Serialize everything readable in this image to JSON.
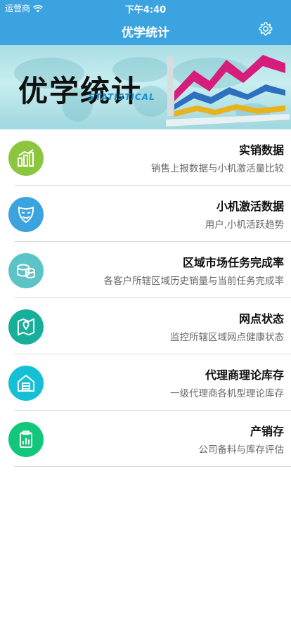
{
  "status_bar": {
    "carrier": "运营商",
    "time": "下午4:40"
  },
  "nav": {
    "title": "优学统计",
    "settings_icon": "gear-icon"
  },
  "banner": {
    "title": "优学统计",
    "subtitle": "STATISTICAL"
  },
  "colors": {
    "nav_bg": "#3aa3e0",
    "icon_green": "#8cc63f",
    "icon_blue": "#3aa3e0",
    "icon_teal": "#5cc4c8",
    "icon_dark_teal": "#16b09a",
    "icon_cyan": "#15c0d6",
    "icon_emerald": "#13c77a"
  },
  "menu": [
    {
      "title": "实销数据",
      "desc": "销售上报数据与小机激活量比较",
      "icon": "bar-chart-icon"
    },
    {
      "title": "小机激活数据",
      "desc": "用户,小机活跃趋势",
      "icon": "mask-icon"
    },
    {
      "title": "区域市场任务完成率",
      "desc": "各客户所辖区域历史销量与当前任务完成率",
      "icon": "coins-icon"
    },
    {
      "title": "网点状态",
      "desc": "监控所辖区域网点健康状态",
      "icon": "map-pin-icon"
    },
    {
      "title": "代理商理论库存",
      "desc": "一级代理商各机型理论库存",
      "icon": "warehouse-icon"
    },
    {
      "title": "产销存",
      "desc": "公司备料与库存评估",
      "icon": "clipboard-icon"
    }
  ]
}
